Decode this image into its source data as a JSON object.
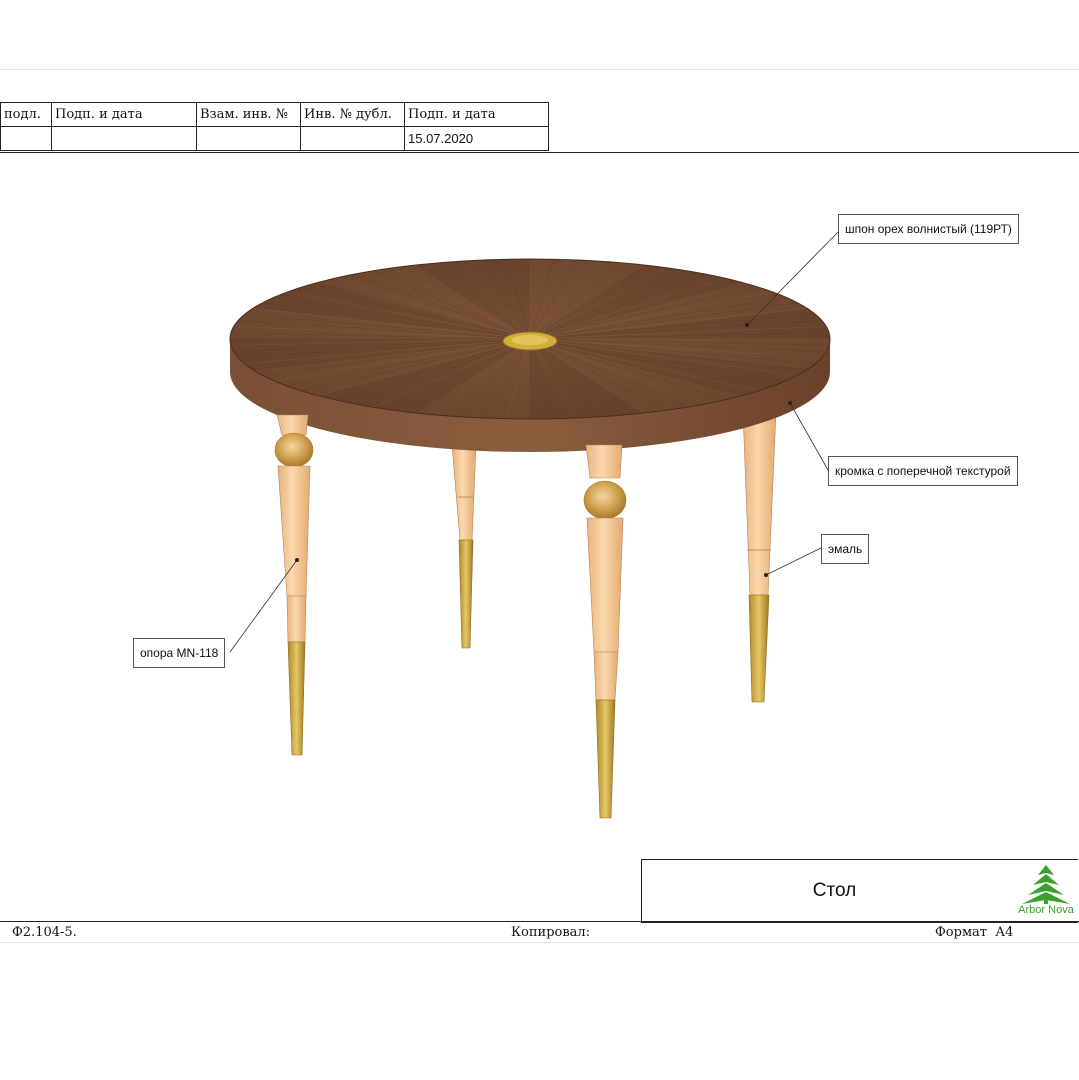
{
  "stamp": {
    "headers": [
      "подл.",
      "Подп. и дата",
      "Взам. инв. №",
      "Инв. № дубл.",
      "Подп. и дата"
    ],
    "values": [
      "",
      "",
      "",
      "",
      "15.07.2020"
    ]
  },
  "callouts": {
    "veneer": "шпон орех волнистый (119РТ)",
    "edge": "кромка с поперечной текстурой",
    "enamel": "эмаль",
    "leg": "опора MN-118"
  },
  "titleblock": {
    "name": "Стол",
    "logo_text": "Arbor Nova"
  },
  "footer": {
    "form": "Ф2.104-5.",
    "copied": "Копировал:",
    "format_label": "Формат",
    "format_value": "А4"
  },
  "colors": {
    "tabletop": "#6b4530",
    "legs": "#f4c796",
    "brass": "#c9a233",
    "logo": "#3aa12f"
  }
}
